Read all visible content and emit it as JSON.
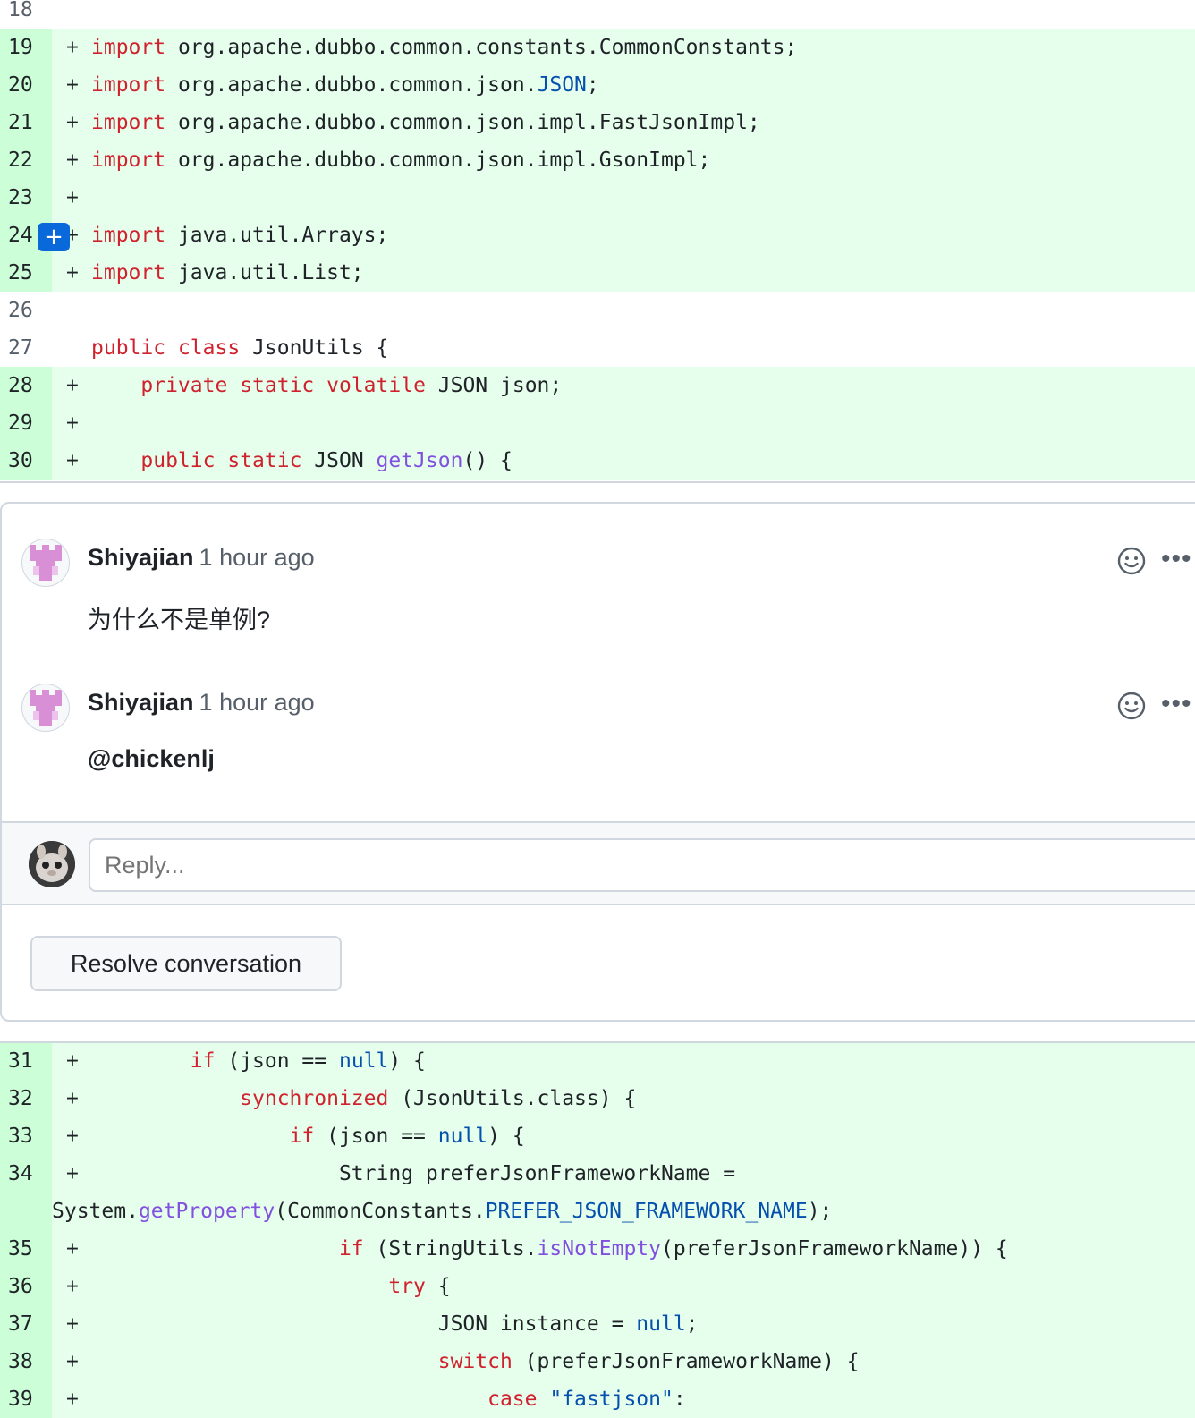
{
  "code_top": [
    {
      "num": "18",
      "type": "ctx",
      "sign": "",
      "tokens": []
    },
    {
      "num": "19",
      "type": "add",
      "sign": "+",
      "tokens": [
        {
          "t": "import",
          "c": "kw"
        },
        {
          "t": " org.apache.dubbo.common.constants.CommonConstants;",
          "c": ""
        }
      ]
    },
    {
      "num": "20",
      "type": "add",
      "sign": "+",
      "tokens": [
        {
          "t": "import",
          "c": "kw"
        },
        {
          "t": " org.apache.dubbo.common.json.",
          "c": ""
        },
        {
          "t": "JSON",
          "c": "cn"
        },
        {
          "t": ";",
          "c": ""
        }
      ]
    },
    {
      "num": "21",
      "type": "add",
      "sign": "+",
      "tokens": [
        {
          "t": "import",
          "c": "kw"
        },
        {
          "t": " org.apache.dubbo.common.json.impl.FastJsonImpl;",
          "c": ""
        }
      ]
    },
    {
      "num": "22",
      "type": "add",
      "sign": "+",
      "tokens": [
        {
          "t": "import",
          "c": "kw"
        },
        {
          "t": " org.apache.dubbo.common.json.impl.GsonImpl;",
          "c": ""
        }
      ]
    },
    {
      "num": "23",
      "type": "add",
      "sign": "+",
      "tokens": []
    },
    {
      "num": "24",
      "type": "add",
      "sign": "+",
      "plus_button": true,
      "tokens": [
        {
          "t": "import",
          "c": "kw"
        },
        {
          "t": " java.util.Arrays;",
          "c": ""
        }
      ]
    },
    {
      "num": "25",
      "type": "add",
      "sign": "+",
      "tokens": [
        {
          "t": "import",
          "c": "kw"
        },
        {
          "t": " java.util.List;",
          "c": ""
        }
      ]
    },
    {
      "num": "26",
      "type": "ctx",
      "sign": "",
      "tokens": []
    },
    {
      "num": "27",
      "type": "ctx",
      "sign": "",
      "tokens": [
        {
          "t": "public",
          "c": "kw"
        },
        {
          "t": " ",
          "c": ""
        },
        {
          "t": "class",
          "c": "kw"
        },
        {
          "t": " JsonUtils {",
          "c": ""
        }
      ]
    },
    {
      "num": "28",
      "type": "add",
      "sign": "+",
      "tokens": [
        {
          "t": "    ",
          "c": ""
        },
        {
          "t": "private",
          "c": "kw"
        },
        {
          "t": " ",
          "c": ""
        },
        {
          "t": "static",
          "c": "kw"
        },
        {
          "t": " ",
          "c": ""
        },
        {
          "t": "volatile",
          "c": "kw"
        },
        {
          "t": " JSON json;",
          "c": ""
        }
      ]
    },
    {
      "num": "29",
      "type": "add",
      "sign": "+",
      "tokens": []
    },
    {
      "num": "30",
      "type": "add",
      "sign": "+",
      "tokens": [
        {
          "t": "    ",
          "c": ""
        },
        {
          "t": "public",
          "c": "kw"
        },
        {
          "t": " ",
          "c": ""
        },
        {
          "t": "static",
          "c": "kw"
        },
        {
          "t": " JSON ",
          "c": ""
        },
        {
          "t": "getJson",
          "c": "fn"
        },
        {
          "t": "() {",
          "c": ""
        }
      ]
    }
  ],
  "thread": {
    "comments": [
      {
        "author": "Shiyajian",
        "time": "1 hour ago",
        "body": "为什么不是单例?",
        "bold": false
      },
      {
        "author": "Shiyajian",
        "time": "1 hour ago",
        "body": "@chickenlj",
        "bold": true
      }
    ],
    "reply_placeholder": "Reply...",
    "resolve_label": "Resolve conversation"
  },
  "code_bottom": [
    {
      "num": "31",
      "type": "add",
      "sign": "+",
      "tokens": [
        {
          "t": "        ",
          "c": ""
        },
        {
          "t": "if",
          "c": "kw"
        },
        {
          "t": " (json == ",
          "c": ""
        },
        {
          "t": "null",
          "c": "cn"
        },
        {
          "t": ") {",
          "c": ""
        }
      ]
    },
    {
      "num": "32",
      "type": "add",
      "sign": "+",
      "tokens": [
        {
          "t": "            ",
          "c": ""
        },
        {
          "t": "synchronized",
          "c": "kw"
        },
        {
          "t": " (JsonUtils.class) {",
          "c": ""
        }
      ]
    },
    {
      "num": "33",
      "type": "add",
      "sign": "+",
      "tokens": [
        {
          "t": "                ",
          "c": ""
        },
        {
          "t": "if",
          "c": "kw"
        },
        {
          "t": " (json == ",
          "c": ""
        },
        {
          "t": "null",
          "c": "cn"
        },
        {
          "t": ") {",
          "c": ""
        }
      ]
    },
    {
      "num": "34",
      "type": "add",
      "sign": "+",
      "wrap": true,
      "tokens": [
        {
          "t": "                    String preferJsonFrameworkName =",
          "c": ""
        }
      ],
      "tokens2": [
        {
          "t": "System.",
          "c": ""
        },
        {
          "t": "getProperty",
          "c": "fn"
        },
        {
          "t": "(CommonConstants.",
          "c": ""
        },
        {
          "t": "PREFER_JSON_FRAMEWORK_NAME",
          "c": "cn"
        },
        {
          "t": ");",
          "c": ""
        }
      ]
    },
    {
      "num": "35",
      "type": "add",
      "sign": "+",
      "tokens": [
        {
          "t": "                    ",
          "c": ""
        },
        {
          "t": "if",
          "c": "kw"
        },
        {
          "t": " (StringUtils.",
          "c": ""
        },
        {
          "t": "isNotEmpty",
          "c": "fn"
        },
        {
          "t": "(preferJsonFrameworkName)) {",
          "c": ""
        }
      ]
    },
    {
      "num": "36",
      "type": "add",
      "sign": "+",
      "tokens": [
        {
          "t": "                        ",
          "c": ""
        },
        {
          "t": "try",
          "c": "kw"
        },
        {
          "t": " {",
          "c": ""
        }
      ]
    },
    {
      "num": "37",
      "type": "add",
      "sign": "+",
      "tokens": [
        {
          "t": "                            JSON instance = ",
          "c": ""
        },
        {
          "t": "null",
          "c": "cn"
        },
        {
          "t": ";",
          "c": ""
        }
      ]
    },
    {
      "num": "38",
      "type": "add",
      "sign": "+",
      "tokens": [
        {
          "t": "                            ",
          "c": ""
        },
        {
          "t": "switch",
          "c": "kw"
        },
        {
          "t": " (preferJsonFrameworkName) {",
          "c": ""
        }
      ]
    },
    {
      "num": "39",
      "type": "add",
      "sign": "+",
      "tokens": [
        {
          "t": "                                ",
          "c": ""
        },
        {
          "t": "case",
          "c": "kw"
        },
        {
          "t": " ",
          "c": ""
        },
        {
          "t": "\"fastjson\"",
          "c": "cn"
        },
        {
          "t": ":",
          "c": ""
        }
      ]
    }
  ],
  "icons": {
    "add_comment": "plus-icon",
    "reaction": "smiley-icon",
    "more": "kebab-horizontal-icon"
  },
  "colors": {
    "added_line_bg": "#e6ffec",
    "added_num_bg": "#ccffd8",
    "keyword": "#cf222e",
    "function": "#8250df",
    "constant": "#0550ae",
    "accent": "#0969da"
  }
}
